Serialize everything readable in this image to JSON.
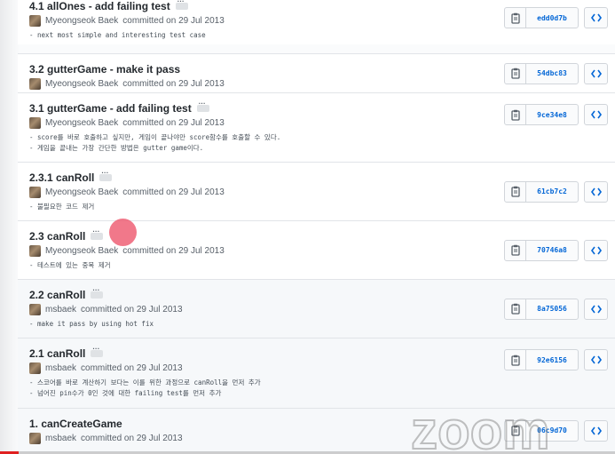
{
  "commits": [
    {
      "title": "4.1 allOnes - add failing test",
      "author": "Myeongseok Baek",
      "committed": "committed on 29 Jul 2013",
      "desc": "- next most simple and interesting test case",
      "sha": "edd0d7b",
      "has_ellipsis": true
    },
    {
      "title": "3.2 gutterGame - make it pass",
      "author": "Myeongseok Baek",
      "committed": "committed on 29 Jul 2013",
      "desc": "",
      "sha": "54dbc83",
      "has_ellipsis": false
    },
    {
      "title": "3.1 gutterGame - add failing test",
      "author": "Myeongseok Baek",
      "committed": "committed on 29 Jul 2013",
      "desc": "- score를 바로 호출하고 싶지만, 게임이 끝나야만 score함수를 호출할 수 있다.\n- 게임을 끝내는 가장 간단한 방법은 gutter game이다.",
      "sha": "9ce34e8",
      "has_ellipsis": true
    },
    {
      "title": "2.3.1 canRoll",
      "author": "Myeongseok Baek",
      "committed": "committed on 29 Jul 2013",
      "desc": "- 불필요한 코드 제거",
      "sha": "61cb7c2",
      "has_ellipsis": true
    },
    {
      "title": "2.3 canRoll",
      "author": "Myeongseok Baek",
      "committed": "committed on 29 Jul 2013",
      "desc": "- 테스트에 있는 중복 제거",
      "sha": "70746a8",
      "has_ellipsis": true
    },
    {
      "title": "2.2 canRoll",
      "author": "msbaek",
      "committed": "committed on 29 Jul 2013",
      "desc": "- make it pass by using hot fix",
      "sha": "8a75056",
      "has_ellipsis": true
    },
    {
      "title": "2.1 canRoll",
      "author": "msbaek",
      "committed": "committed on 29 Jul 2013",
      "desc": "- 스코어를 바로 계산하기 보다는 이를 위한 과정으로 canRoll을 먼저 추가\n- 넘어진 pin수가 0인 것에 대한 failing test를 먼저 추가",
      "sha": "92e6156",
      "has_ellipsis": true
    },
    {
      "title": "1. canCreateGame",
      "author": "msbaek",
      "committed": "committed on 29 Jul 2013",
      "desc": "",
      "sha": "06c9d70",
      "has_ellipsis": false
    }
  ],
  "watermark": "zoom",
  "video_progress": 0.03,
  "colors": {
    "link": "#0366d6",
    "cursor": "#ee5a70",
    "progress": "#e02020"
  }
}
